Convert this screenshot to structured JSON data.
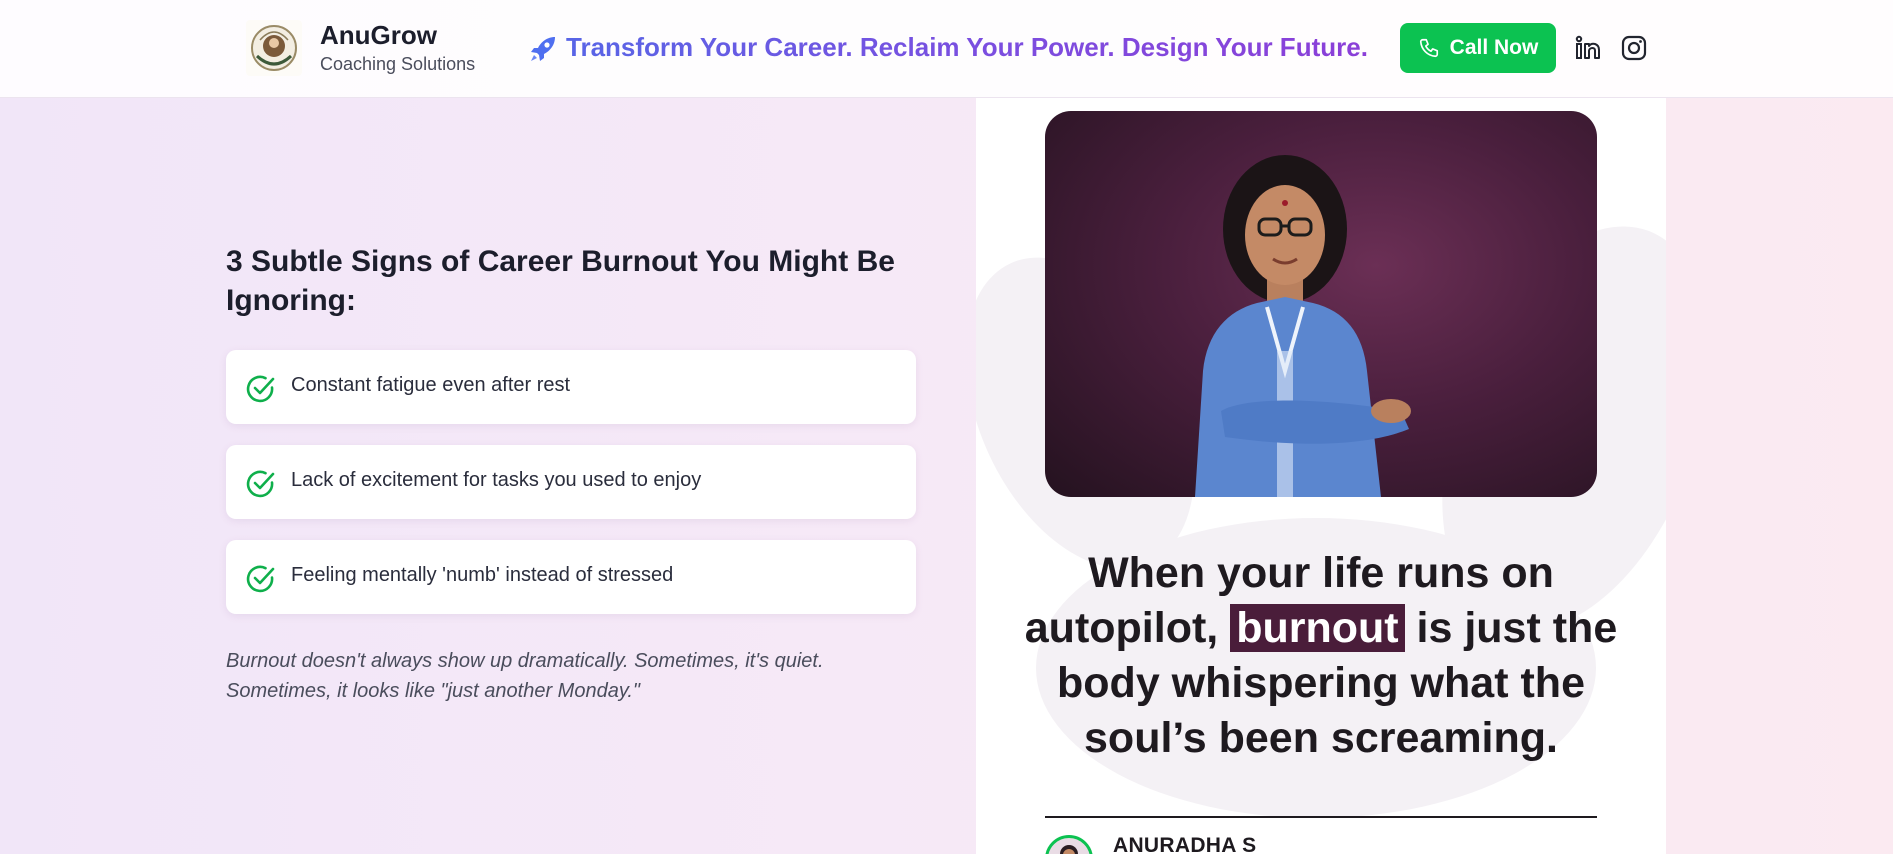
{
  "header": {
    "brand_name": "AnuGrow",
    "brand_sub": "Coaching Solutions",
    "tagline": "Transform Your Career. Reclaim Your Power. Design Your Future.",
    "call_label": "Call Now",
    "icons": [
      "logo-emblem",
      "rocket-icon",
      "phone-icon",
      "linkedin-icon",
      "instagram-icon"
    ]
  },
  "signs": {
    "heading": "3 Subtle Signs of Career Burnout You Might Be Ignoring:",
    "items": [
      "Constant fatigue even after rest",
      "Lack of excitement for tasks you used to enjoy",
      "Feeling mentally 'numb' instead of stressed"
    ],
    "note": "Burnout doesn't always show up dramatically. Sometimes, it's quiet. Sometimes, it looks like \"just another Monday.\""
  },
  "quote_card": {
    "quote_before": "When your life runs on autopilot,",
    "quote_highlight": "burnout",
    "quote_after": "is just the body whispering what the soul’s been screaming.",
    "author": "ANURADHA S"
  },
  "colors": {
    "accent_green": "#0cc251",
    "tagline_start": "#5865e6",
    "tagline_end": "#8b3fd8",
    "highlight_bg": "#4a1d3a"
  }
}
